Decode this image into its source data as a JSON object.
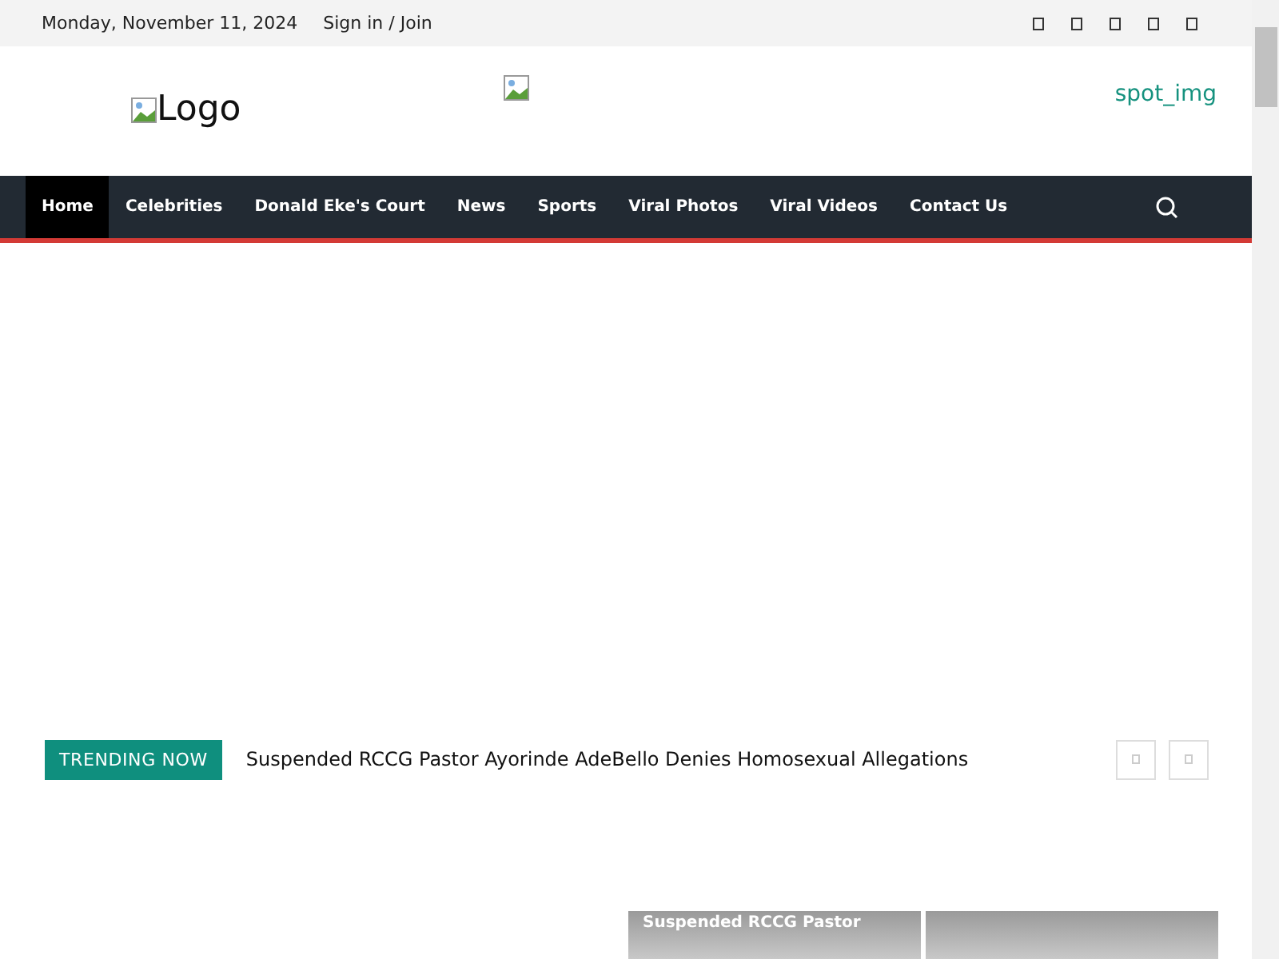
{
  "top_bar": {
    "date": "Monday, November 11, 2024",
    "sign_in": "Sign in / Join"
  },
  "header": {
    "logo_alt": "Logo",
    "spot": "spot_img"
  },
  "nav": {
    "items": [
      {
        "label": "Home",
        "selected": true
      },
      {
        "label": "Celebrities",
        "selected": false
      },
      {
        "label": "Donald Eke's Court",
        "selected": false
      },
      {
        "label": "News",
        "selected": false
      },
      {
        "label": "Sports",
        "selected": false
      },
      {
        "label": "Viral Photos",
        "selected": false
      },
      {
        "label": "Viral Videos",
        "selected": false
      },
      {
        "label": "Contact Us",
        "selected": false
      }
    ]
  },
  "trending": {
    "label": "TRENDING NOW",
    "headline": "Suspended RCCG Pastor Ayorinde AdeBello Denies Homosexual Allegations"
  },
  "cards": [
    {
      "kind": "text",
      "title": "Suspended RCCG Pastor"
    },
    {
      "kind": "blank"
    }
  ]
}
